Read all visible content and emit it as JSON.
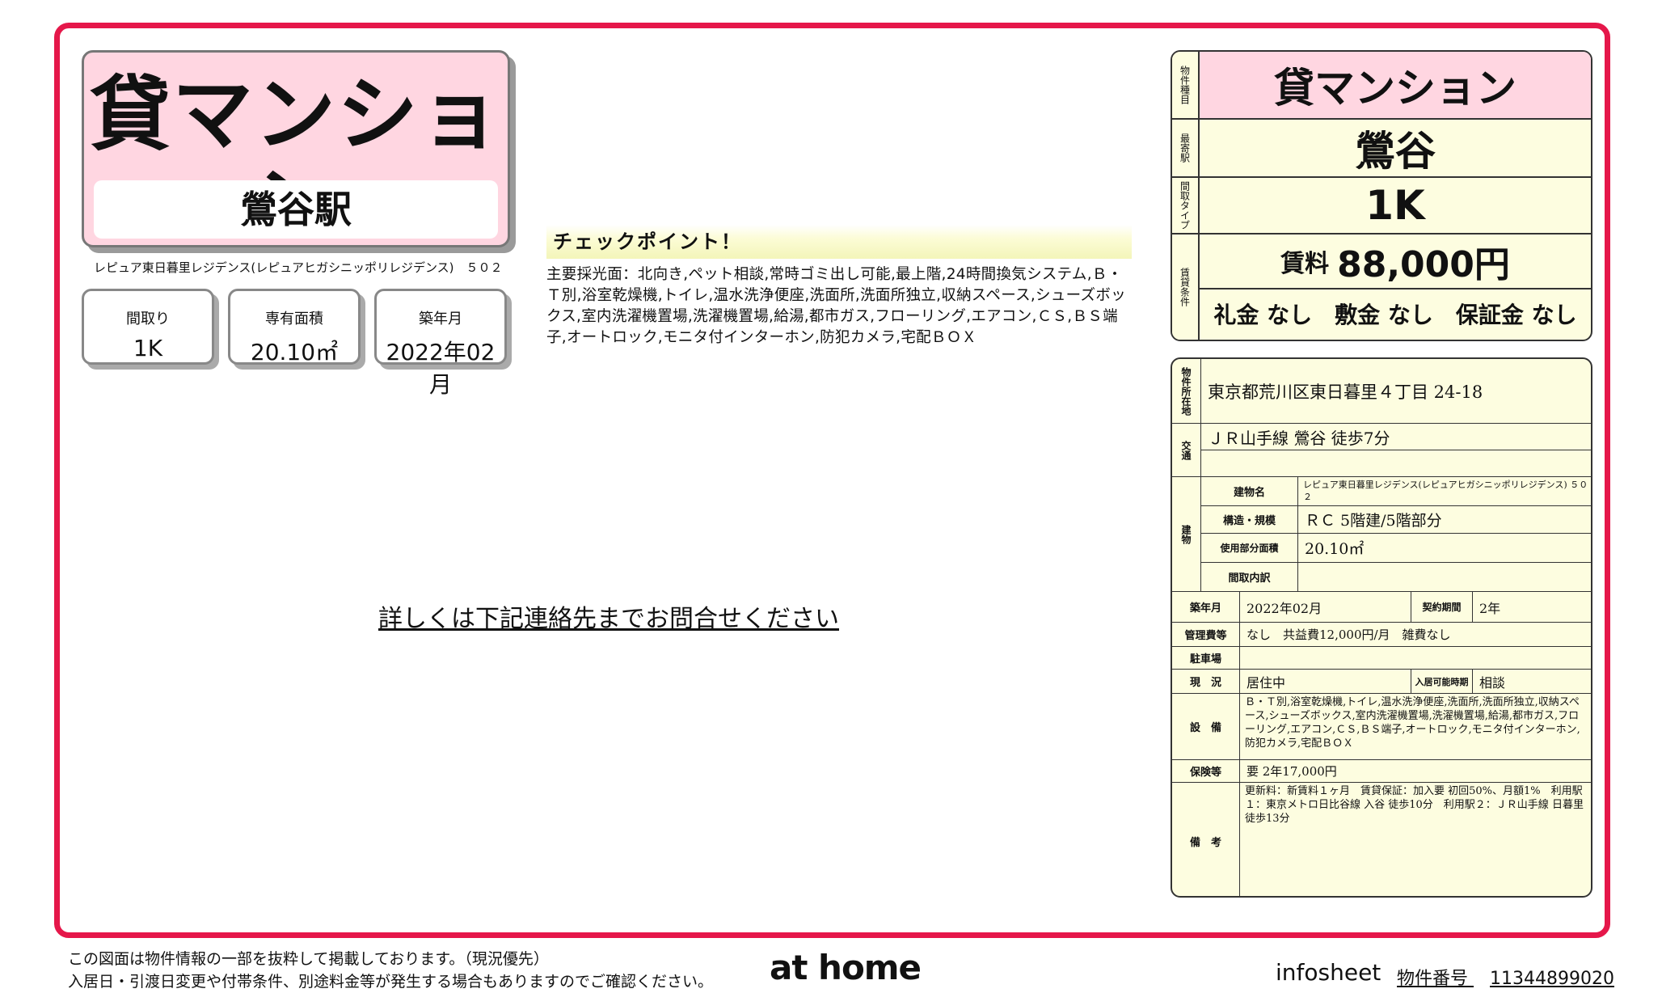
{
  "title": {
    "main": "貸マンション",
    "station": "鶯谷駅"
  },
  "building_name_small": "レピュア東日暮里レジデンス(レピュアヒガシニッポリレジデンス)　５０２",
  "info_boxes": [
    {
      "label": "間取り",
      "value": "1K"
    },
    {
      "label": "専有面積",
      "value": "20.10㎡"
    },
    {
      "label": "築年月",
      "value": "2022年02月"
    }
  ],
  "checkpoint": {
    "heading": "チェックポイント！",
    "text": "主要採光面：北向き,ペット相談,常時ゴミ出し可能,最上階,24時間換気システム,Ｂ・Ｔ別,浴室乾燥機,トイレ,温水洗浄便座,洗面所,洗面所独立,収納スペース,シューズボックス,室内洗濯機置場,洗濯機置場,給湯,都市ガス,フローリング,エアコン,ＣＳ,ＢＳ端子,オートロック,モニタ付インターホン,防犯カメラ,宅配ＢＯＸ"
  },
  "contact_text": "詳しくは下記連絡先までお問合せください",
  "summary": {
    "type_label": "物件種目",
    "type": "貸マンション",
    "station_label": "最寄駅",
    "station": "鶯谷",
    "layout_label": "間取タイプ",
    "layout": "1K",
    "terms_label": "賃貸条件",
    "rent_prefix": "賃料",
    "rent": "88,000円",
    "fees": "礼金 なし　敷金 なし　保証金 なし"
  },
  "details": {
    "address_label": "物件所在地",
    "address": "東京都荒川区東日暮里４丁目 24-18",
    "transport_label": "交通",
    "transport": "ＪＲ山手線 鶯谷 徒歩7分",
    "building_label": "建物",
    "bname_label": "建物名",
    "bname": "レピュア東日暮里レジデンス(レピュアヒガシニッポリレジデンス) ５０２",
    "struct_label": "構造・規模",
    "struct": "ＲＣ 5階建/5階部分",
    "area_label": "使用部分面積",
    "area": "20.10㎡",
    "layout_detail_label": "間取内訳",
    "layout_detail": "",
    "built_label": "築年月",
    "built": "2022年02月",
    "contract_label": "契約期間",
    "contract": "2年",
    "mgmt_label": "管理費等",
    "mgmt": "なし　共益費12,000円/月　雑費なし",
    "parking_label": "駐車場",
    "parking": "",
    "status_label": "現　況",
    "status": "居住中",
    "movein_label": "入居可能時期",
    "movein": "相談",
    "equip_label": "設　備",
    "equip": "Ｂ・Ｔ別,浴室乾燥機,トイレ,温水洗浄便座,洗面所,洗面所独立,収納スペース,シューズボックス,室内洗濯機置場,洗濯機置場,給湯,都市ガス,フローリング,エアコン,ＣＳ,ＢＳ端子,オートロック,モニタ付インターホン,防犯カメラ,宅配ＢＯＸ",
    "insurance_label": "保険等",
    "insurance": "要 2年17,000円",
    "remarks_label": "備　考",
    "remarks": "更新料：新賃料１ヶ月　賃貸保証：加入要 初回50%、月額1%　利用駅１：東京メトロ日比谷線 入谷 徒歩10分　利用駅２：ＪＲ山手線 日暮里 徒歩13分"
  },
  "footer": {
    "note1": "この図面は物件情報の一部を抜粋して掲載しております。（現況優先）",
    "note2": "入居日・引渡日変更や付帯条件、別途料金等が発生する場合もありますのでご確認ください。",
    "logo": "at home",
    "infosheet": "infosheet",
    "property_no_label": "物件番号",
    "property_no": "11344899020"
  },
  "colors": {
    "frame": "#e5174a",
    "title_bg": "#ffd6e1",
    "panel_bg": "#fdfde0"
  }
}
